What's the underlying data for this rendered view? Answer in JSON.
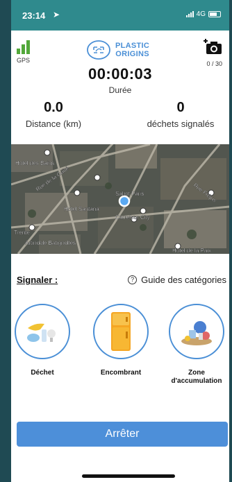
{
  "status": {
    "time": "23:14",
    "network": "4G"
  },
  "gps": {
    "label": "GPS"
  },
  "logo": {
    "line1": "PLASTIC",
    "line2": "ORIGINS"
  },
  "camera": {
    "count": "0 / 30"
  },
  "timer": {
    "value": "00:00:03",
    "label": "Durée"
  },
  "stats": {
    "distance_value": "0.0",
    "distance_label": "Distance (km)",
    "waste_value": "0",
    "waste_label": "déchets signalés"
  },
  "map": {
    "labels": [
      "Hotel des Bains",
      "Rue de la Gaîté",
      "Hotel Santana",
      "Sabot Paris",
      "Carrefour City",
      "Trente",
      "Artinoble Batignolles",
      "Rue Fréjus",
      "Hotel de la Paix"
    ]
  },
  "signal": {
    "label": "Signaler :",
    "guide": "Guide des catégories",
    "help_glyph": "?"
  },
  "categories": [
    {
      "label": "Déchet"
    },
    {
      "label": "Encombrant"
    },
    {
      "label_line1": "Zone",
      "label_line2": "d'accumulation"
    }
  ],
  "stop_button": {
    "label": "Arrêter"
  },
  "colors": {
    "status_bar": "#2f8a8d",
    "accent_blue": "#4d8fd9",
    "gps_green": "#52a83a",
    "frame": "#234e57"
  }
}
